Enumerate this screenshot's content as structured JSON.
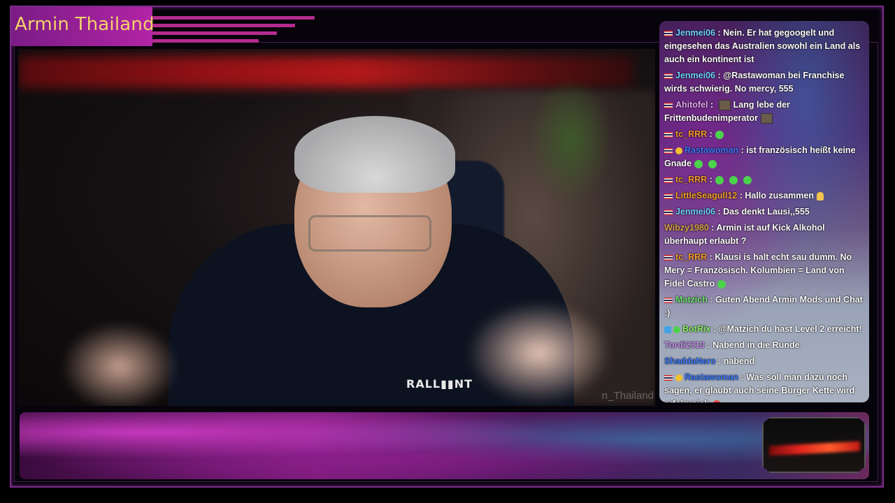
{
  "channel": {
    "title": "Armin Thailand"
  },
  "video": {
    "shirt_logo": "RALL▮▮NT",
    "watermark": "n_Thailand"
  },
  "chat": {
    "messages": [
      {
        "user": "Jenmei06",
        "color": "#6fd3ff",
        "text": ": Nein. Er hat gegoogelt und eingesehen das Australien sowohl ein Land als auch ein kontinent ist",
        "flag": true
      },
      {
        "user": "Jenmei06",
        "color": "#6fd3ff",
        "text": ": @Rastawoman bei Franchise wirds schwierig. No mercy, 555",
        "flag": true
      },
      {
        "user": "Ahitofel",
        "color": "#e2aaf0",
        "text": ": Lang lebe der Frittenbudenimperator",
        "flag": true,
        "emote_before": "square",
        "emote_after": "square"
      },
      {
        "user": "tc_RRR",
        "color": "#f29a2a",
        "text": ":",
        "flag": true,
        "emotes": 1
      },
      {
        "user": "Rastawoman",
        "color": "#3c7bff",
        "text": ": ist französisch heißt keine Gnade",
        "flag": true,
        "badge": "#f2c12e",
        "emotes_end": 2
      },
      {
        "user": "tc_RRR",
        "color": "#f29a2a",
        "text": ":",
        "flag": true,
        "emotes": 3
      },
      {
        "user": "LittleSeagull12",
        "color": "#f2a02a",
        "text": ": Hallo zusammen",
        "flag": true,
        "emote_end": "pray"
      },
      {
        "user": "Jenmei06",
        "color": "#6fd3ff",
        "text": ": Das denkt Lausi,,555",
        "flag": true
      },
      {
        "user": "Wibzy1980",
        "color": "#d7a44a",
        "text": ": Armin ist auf Kick Alkohol überhaupt erlaubt ?",
        "flag": false
      },
      {
        "user": "tc_RRR",
        "color": "#f29a2a",
        "text": ": Klausi is halt echt sau dumm. No Mery = Französisch. Kolumbien = Land von Fidel Castro",
        "flag": true,
        "emotes_end": 1
      },
      {
        "user": "Matzich",
        "color": "#6fe36f",
        "text": ": Guten Abend Armin Mods und Chat :)",
        "flag": true
      },
      {
        "user": "BotRix",
        "color": "#8df06a",
        "text": ": @Matzich du hast Level 2 erreicht!",
        "flag": false,
        "bot": true
      },
      {
        "user": "Tordi2310",
        "color": "#c98ff0",
        "text": ": Nabend in die Runde",
        "flag": false
      },
      {
        "user": "ShaddaNero",
        "color": "#3c7bff",
        "text": ": nabend",
        "flag": false
      },
      {
        "user": "Rastawoman",
        "color": "#3c7bff",
        "text": ": Was soll man dazu noch sagen, er glaubt auch seine Burger Kette wird erfolgreich",
        "flag": true,
        "badge": "#f2c12e",
        "emote_end": "laugh"
      }
    ]
  }
}
